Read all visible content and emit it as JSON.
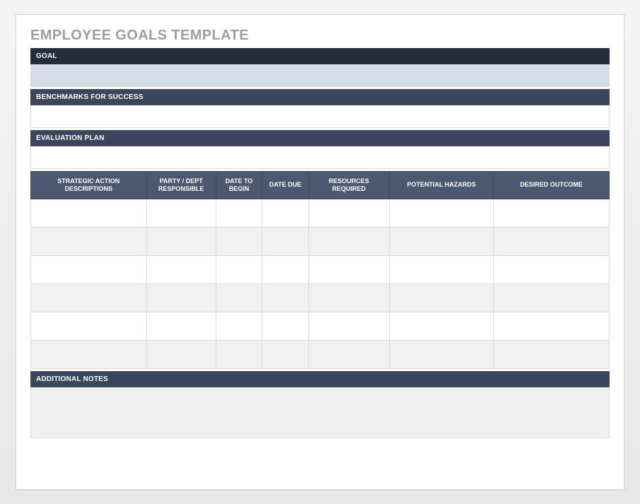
{
  "title": "EMPLOYEE GOALS TEMPLATE",
  "sections": {
    "goal": "GOAL",
    "benchmarks": "BENCHMARKS FOR SUCCESS",
    "evaluation": "EVALUATION PLAN",
    "notes": "ADDITIONAL NOTES"
  },
  "actionTable": {
    "headers": {
      "desc": "STRATEGIC ACTION DESCRIPTIONS",
      "party": "PARTY / DEPT RESPONSIBLE",
      "begin": "DATE TO BEGIN",
      "due": "DATE DUE",
      "resources": "RESOURCES REQUIRED",
      "hazards": "POTENTIAL HAZARDS",
      "outcome": "DESIRED OUTCOME"
    },
    "rows": [
      {
        "desc": "",
        "party": "",
        "begin": "",
        "due": "",
        "resources": "",
        "hazards": "",
        "outcome": ""
      },
      {
        "desc": "",
        "party": "",
        "begin": "",
        "due": "",
        "resources": "",
        "hazards": "",
        "outcome": ""
      },
      {
        "desc": "",
        "party": "",
        "begin": "",
        "due": "",
        "resources": "",
        "hazards": "",
        "outcome": ""
      },
      {
        "desc": "",
        "party": "",
        "begin": "",
        "due": "",
        "resources": "",
        "hazards": "",
        "outcome": ""
      },
      {
        "desc": "",
        "party": "",
        "begin": "",
        "due": "",
        "resources": "",
        "hazards": "",
        "outcome": ""
      },
      {
        "desc": "",
        "party": "",
        "begin": "",
        "due": "",
        "resources": "",
        "hazards": "",
        "outcome": ""
      }
    ]
  },
  "values": {
    "goal": "",
    "benchmarks": "",
    "evaluation": "",
    "notes": ""
  }
}
